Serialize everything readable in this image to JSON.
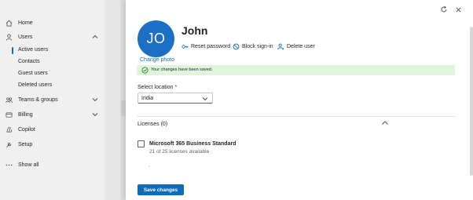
{
  "sidebar": {
    "items": [
      {
        "label": "Home",
        "icon": "home-icon"
      },
      {
        "label": "Users",
        "icon": "person-icon",
        "expanded": true
      },
      {
        "label": "Teams & groups",
        "icon": "teams-groups-icon",
        "expanded": false
      },
      {
        "label": "Billing",
        "icon": "credit-card-icon",
        "expanded": false
      },
      {
        "label": "Copilot",
        "icon": "copilot-icon"
      },
      {
        "label": "Setup",
        "icon": "wrench-icon"
      },
      {
        "label": "Show all",
        "icon": "ellipsis-icon"
      }
    ],
    "users_sub": [
      {
        "label": "Active users",
        "active": true
      },
      {
        "label": "Contacts",
        "active": false
      },
      {
        "label": "Guest users",
        "active": false
      },
      {
        "label": "Deleted users",
        "active": false
      }
    ]
  },
  "panel": {
    "avatar_initials": "JO",
    "change_photo": "Change photo",
    "user_name": "John",
    "actions": {
      "reset_password": "Reset password",
      "block_signin": "Block sign-in",
      "delete_user": "Delete user"
    },
    "success_message": "Your changes have been saved.",
    "location": {
      "label": "Select location",
      "required_marker": "*",
      "value": "India"
    },
    "licenses": {
      "header": "Licenses (0)",
      "items": [
        {
          "name": "Microsoft 365 Business Standard",
          "availability": "21 of 25 licenses available",
          "checked": false
        }
      ]
    },
    "save_button": "Save changes"
  },
  "colors": {
    "accent": "#0f6cbd",
    "avatar": "#1b6fc5",
    "success_bg": "#dff6dd",
    "success_icon": "#107c10",
    "required": "#c50f1f"
  }
}
